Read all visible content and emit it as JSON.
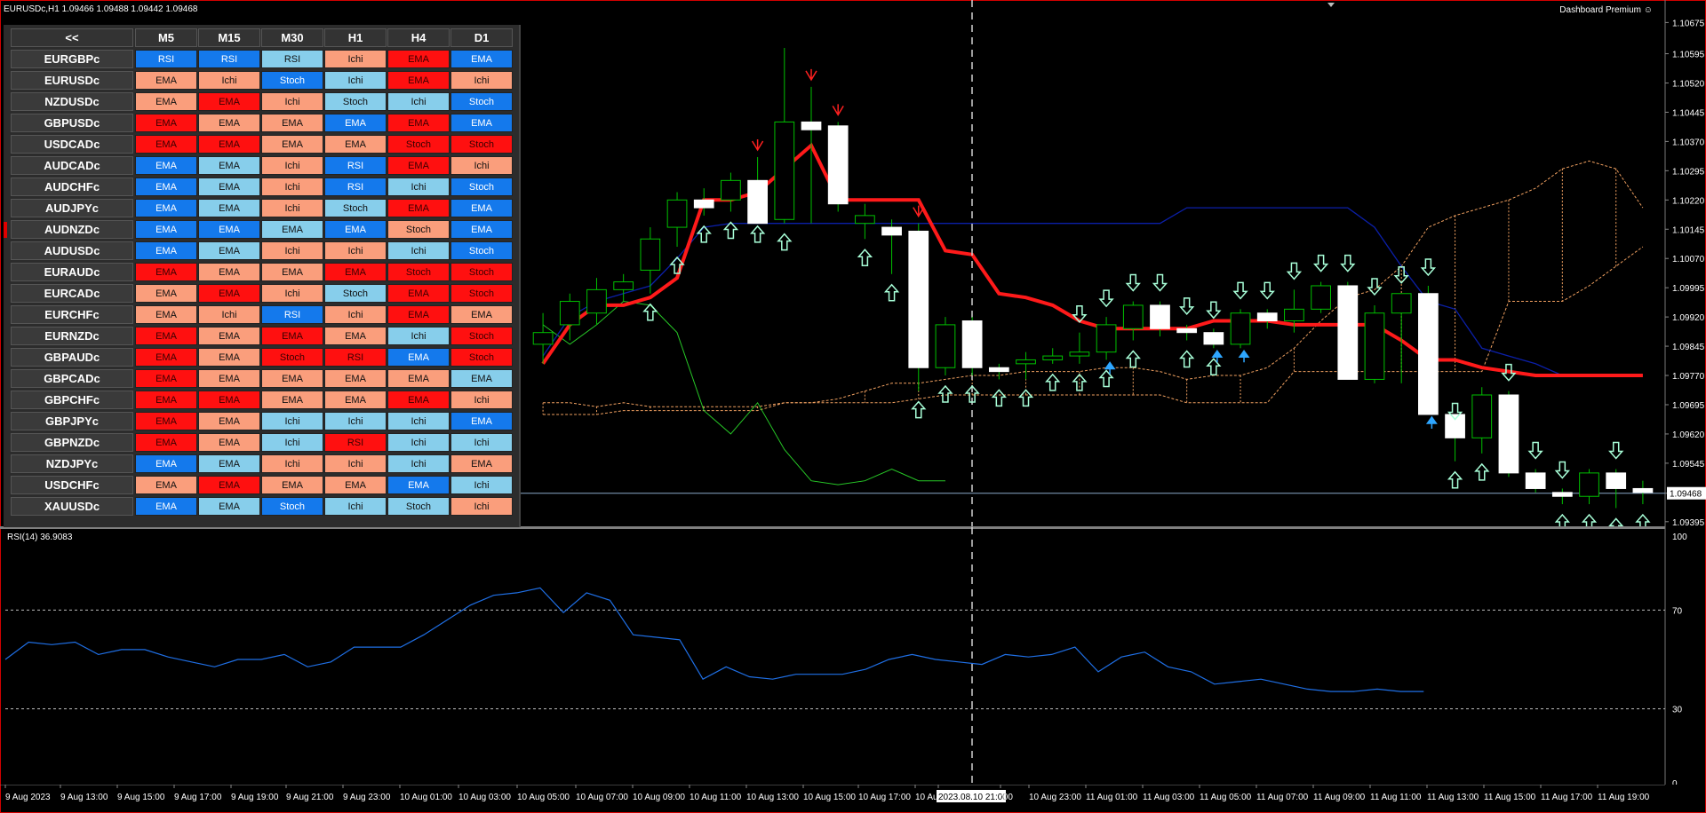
{
  "header": {
    "symbol_info": "EURUSDc,H1  1.09466 1.09488 1.09442 1.09468",
    "dashboard_title": "Dashboard Premium ☺"
  },
  "dashboard": {
    "back_label": "<<",
    "timeframes": [
      "M5",
      "M15",
      "M30",
      "H1",
      "H4",
      "D1"
    ],
    "rows": [
      {
        "symbol": "EURGBPc",
        "signals": [
          "RSI",
          "RSI",
          "RSI",
          "Ichi",
          "EMA",
          "EMA"
        ],
        "colors": [
          "blue",
          "blue",
          "lightblue",
          "salmon",
          "red",
          "blue"
        ]
      },
      {
        "symbol": "EURUSDc",
        "signals": [
          "EMA",
          "Ichi",
          "Stoch",
          "Ichi",
          "EMA",
          "Ichi"
        ],
        "colors": [
          "salmon",
          "salmon",
          "blue",
          "lightblue",
          "red",
          "salmon"
        ]
      },
      {
        "symbol": "NZDUSDc",
        "signals": [
          "EMA",
          "EMA",
          "Ichi",
          "Stoch",
          "Ichi",
          "Stoch"
        ],
        "colors": [
          "salmon",
          "red",
          "salmon",
          "lightblue",
          "lightblue",
          "blue"
        ]
      },
      {
        "symbol": "GBPUSDc",
        "signals": [
          "EMA",
          "EMA",
          "EMA",
          "EMA",
          "EMA",
          "EMA"
        ],
        "colors": [
          "red",
          "salmon",
          "salmon",
          "blue",
          "red",
          "blue"
        ]
      },
      {
        "symbol": "USDCADc",
        "signals": [
          "EMA",
          "EMA",
          "EMA",
          "EMA",
          "Stoch",
          "Stoch"
        ],
        "colors": [
          "red",
          "red",
          "salmon",
          "salmon",
          "red",
          "red"
        ]
      },
      {
        "symbol": "AUDCADc",
        "signals": [
          "EMA",
          "EMA",
          "Ichi",
          "RSI",
          "EMA",
          "Ichi"
        ],
        "colors": [
          "blue",
          "lightblue",
          "salmon",
          "blue",
          "red",
          "salmon"
        ]
      },
      {
        "symbol": "AUDCHFc",
        "signals": [
          "EMA",
          "EMA",
          "Ichi",
          "RSI",
          "Ichi",
          "Stoch"
        ],
        "colors": [
          "blue",
          "lightblue",
          "salmon",
          "blue",
          "lightblue",
          "blue"
        ]
      },
      {
        "symbol": "AUDJPYc",
        "signals": [
          "EMA",
          "EMA",
          "Ichi",
          "Stoch",
          "EMA",
          "EMA"
        ],
        "colors": [
          "blue",
          "lightblue",
          "salmon",
          "lightblue",
          "red",
          "blue"
        ]
      },
      {
        "symbol": "AUDNZDc",
        "signals": [
          "EMA",
          "EMA",
          "EMA",
          "EMA",
          "Stoch",
          "EMA"
        ],
        "colors": [
          "blue",
          "blue",
          "lightblue",
          "blue",
          "salmon",
          "blue"
        ]
      },
      {
        "symbol": "AUDUSDc",
        "signals": [
          "EMA",
          "EMA",
          "Ichi",
          "Ichi",
          "Ichi",
          "Stoch"
        ],
        "colors": [
          "blue",
          "lightblue",
          "salmon",
          "salmon",
          "lightblue",
          "blue"
        ]
      },
      {
        "symbol": "EURAUDc",
        "signals": [
          "EMA",
          "EMA",
          "EMA",
          "EMA",
          "Stoch",
          "Stoch"
        ],
        "colors": [
          "red",
          "salmon",
          "salmon",
          "red",
          "red",
          "red"
        ]
      },
      {
        "symbol": "EURCADc",
        "signals": [
          "EMA",
          "EMA",
          "Ichi",
          "Stoch",
          "EMA",
          "Stoch"
        ],
        "colors": [
          "salmon",
          "red",
          "salmon",
          "lightblue",
          "red",
          "red"
        ]
      },
      {
        "symbol": "EURCHFc",
        "signals": [
          "EMA",
          "Ichi",
          "RSI",
          "Ichi",
          "EMA",
          "EMA"
        ],
        "colors": [
          "salmon",
          "salmon",
          "blue",
          "salmon",
          "red",
          "salmon"
        ]
      },
      {
        "symbol": "EURNZDc",
        "signals": [
          "EMA",
          "EMA",
          "EMA",
          "EMA",
          "Ichi",
          "Stoch"
        ],
        "colors": [
          "red",
          "salmon",
          "red",
          "salmon",
          "lightblue",
          "red"
        ]
      },
      {
        "symbol": "GBPAUDc",
        "signals": [
          "EMA",
          "EMA",
          "Stoch",
          "RSI",
          "EMA",
          "Stoch"
        ],
        "colors": [
          "red",
          "salmon",
          "red",
          "red",
          "blue",
          "red"
        ]
      },
      {
        "symbol": "GBPCADc",
        "signals": [
          "EMA",
          "EMA",
          "EMA",
          "EMA",
          "EMA",
          "EMA"
        ],
        "colors": [
          "red",
          "salmon",
          "salmon",
          "salmon",
          "salmon",
          "lightblue"
        ]
      },
      {
        "symbol": "GBPCHFc",
        "signals": [
          "EMA",
          "EMA",
          "EMA",
          "EMA",
          "EMA",
          "Ichi"
        ],
        "colors": [
          "red",
          "red",
          "salmon",
          "salmon",
          "red",
          "salmon"
        ]
      },
      {
        "symbol": "GBPJPYc",
        "signals": [
          "EMA",
          "EMA",
          "Ichi",
          "Ichi",
          "Ichi",
          "EMA"
        ],
        "colors": [
          "red",
          "salmon",
          "lightblue",
          "lightblue",
          "lightblue",
          "blue"
        ]
      },
      {
        "symbol": "GBPNZDc",
        "signals": [
          "EMA",
          "EMA",
          "Ichi",
          "RSI",
          "Ichi",
          "Ichi"
        ],
        "colors": [
          "red",
          "salmon",
          "lightblue",
          "red",
          "lightblue",
          "lightblue"
        ]
      },
      {
        "symbol": "NZDJPYc",
        "signals": [
          "EMA",
          "EMA",
          "Ichi",
          "Ichi",
          "Ichi",
          "EMA"
        ],
        "colors": [
          "blue",
          "lightblue",
          "salmon",
          "salmon",
          "lightblue",
          "salmon"
        ]
      },
      {
        "symbol": "USDCHFc",
        "signals": [
          "EMA",
          "EMA",
          "EMA",
          "EMA",
          "EMA",
          "Ichi"
        ],
        "colors": [
          "salmon",
          "red",
          "salmon",
          "salmon",
          "blue",
          "lightblue"
        ]
      },
      {
        "symbol": "XAUUSDc",
        "signals": [
          "EMA",
          "EMA",
          "Stoch",
          "Ichi",
          "Stoch",
          "Ichi"
        ],
        "colors": [
          "blue",
          "lightblue",
          "blue",
          "lightblue",
          "lightblue",
          "salmon"
        ]
      }
    ],
    "cell_colors": {
      "blue": "#1479ec",
      "lightblue": "#87ceeb",
      "salmon": "#fa9e7c",
      "red": "#ff1010"
    },
    "marker_row": 8
  },
  "chart_data": [
    {
      "type": "candlestick",
      "symbol": "EURUSDc",
      "timeframe": "H1",
      "price_levels": [
        "1.10675",
        "1.10595",
        "1.10520",
        "1.10445",
        "1.10370",
        "1.10295",
        "1.10220",
        "1.10145",
        "1.10070",
        "1.09995",
        "1.09920",
        "1.09845",
        "1.09770",
        "1.09695",
        "1.09620",
        "1.09545",
        "1.09468",
        "1.09395"
      ],
      "current_price": 1.09468,
      "ylim": [
        1.0939,
        1.1071
      ],
      "candles": [
        [
          1.0985,
          1.0993,
          1.098,
          1.0988
        ],
        [
          1.099,
          1.0998,
          1.0986,
          1.0996
        ],
        [
          1.0993,
          1.1002,
          1.099,
          1.0999
        ],
        [
          1.0999,
          1.1003,
          1.0996,
          1.1001
        ],
        [
          1.1004,
          1.1015,
          1.0998,
          1.1012
        ],
        [
          1.1015,
          1.1024,
          1.101,
          1.1022
        ],
        [
          1.1022,
          1.1025,
          1.1018,
          1.102
        ],
        [
          1.1022,
          1.1029,
          1.1019,
          1.1027
        ],
        [
          1.1027,
          1.1033,
          1.1018,
          1.1016
        ],
        [
          1.1017,
          1.1061,
          1.1016,
          1.1042
        ],
        [
          1.1042,
          1.1051,
          1.1016,
          1.104
        ],
        [
          1.1041,
          1.1042,
          1.1019,
          1.1021
        ],
        [
          1.1016,
          1.1021,
          1.1012,
          1.1018
        ],
        [
          1.1015,
          1.1017,
          1.1003,
          1.1013
        ],
        [
          1.1014,
          1.1016,
          1.0973,
          1.0979
        ],
        [
          1.0979,
          1.0992,
          1.0977,
          1.099
        ],
        [
          1.0991,
          1.0992,
          1.0977,
          1.0979
        ],
        [
          1.0979,
          1.098,
          1.0976,
          1.0978
        ],
        [
          1.098,
          1.0983,
          1.0976,
          1.0981
        ],
        [
          1.0981,
          1.0984,
          1.098,
          1.0982
        ],
        [
          1.0982,
          1.0988,
          1.098,
          1.0983
        ],
        [
          1.0983,
          1.0992,
          1.0981,
          1.099
        ],
        [
          1.0989,
          1.0996,
          1.0986,
          1.0995
        ],
        [
          1.0995,
          1.0996,
          1.0987,
          1.0989
        ],
        [
          1.0989,
          1.099,
          1.0986,
          1.0988
        ],
        [
          1.0988,
          1.0989,
          1.0984,
          1.0985
        ],
        [
          1.0985,
          1.0994,
          1.0984,
          1.0993
        ],
        [
          1.0993,
          1.0994,
          1.0989,
          1.0991
        ],
        [
          1.0991,
          1.0999,
          1.0988,
          1.0994
        ],
        [
          1.0994,
          1.1001,
          1.0993,
          1.1
        ],
        [
          1.1,
          1.1001,
          1.0976,
          1.0976
        ],
        [
          1.0976,
          1.0995,
          1.0975,
          1.0993
        ],
        [
          1.0993,
          1.0998,
          1.0975,
          1.0998
        ],
        [
          1.0998,
          1.1,
          1.0967,
          1.0967
        ],
        [
          1.0967,
          1.0963,
          1.0955,
          1.0961
        ],
        [
          1.0961,
          1.0974,
          1.0957,
          1.0972
        ],
        [
          1.0972,
          1.0973,
          1.0951,
          1.0952
        ],
        [
          1.0952,
          1.0953,
          1.0947,
          1.0948
        ],
        [
          1.0947,
          1.0948,
          1.0944,
          1.0946
        ],
        [
          1.0946,
          1.0953,
          1.0944,
          1.0952
        ],
        [
          1.0952,
          1.0953,
          1.0943,
          1.0948
        ],
        [
          1.0948,
          1.095,
          1.0944,
          1.0947
        ]
      ],
      "red_line": [
        1.098,
        1.099,
        1.0995,
        1.0995,
        1.0997,
        1.1002,
        1.1022,
        1.1022,
        1.1024,
        1.103,
        1.1036,
        1.1022,
        1.1022,
        1.1022,
        1.1022,
        1.1009,
        1.1008,
        1.0998,
        1.0997,
        1.0995,
        1.0991,
        1.0989,
        1.0989,
        1.0989,
        1.0989,
        1.0991,
        1.0991,
        1.0991,
        1.099,
        1.099,
        1.099,
        1.099,
        1.0986,
        1.0981,
        1.0981,
        1.0979,
        1.0978,
        1.0977,
        1.0977,
        1.0977,
        1.0977,
        1.0977
      ],
      "blue_line": [
        1.0982,
        1.0992,
        1.0996,
        1.0998,
        1.1,
        1.1007,
        1.1015,
        1.1016,
        1.1016,
        1.1016,
        1.1016,
        1.1016,
        1.1016,
        1.1016,
        1.1016,
        1.1016,
        1.1016,
        1.1016,
        1.1016,
        1.1016,
        1.1016,
        1.1016,
        1.1016,
        1.1016,
        1.102,
        1.102,
        1.102,
        1.102,
        1.102,
        1.102,
        1.102,
        1.1015,
        1.1005,
        1.0996,
        1.0994,
        1.0984,
        1.0982,
        1.098,
        1.0977,
        1.0977,
        1.0977,
        1.0977
      ],
      "green_line": [
        1.099,
        1.0985,
        1.099,
        1.0996,
        1.0995,
        1.0988,
        1.0968,
        1.0962,
        1.097,
        1.0958,
        1.095,
        1.0949,
        1.095,
        1.0953,
        1.095,
        1.095
      ],
      "cloud_a": [
        1.097,
        1.097,
        1.0969,
        1.097,
        1.0969,
        1.0969,
        1.0969,
        1.0969,
        1.0969,
        1.097,
        1.097,
        1.0971,
        1.0973,
        1.0975,
        1.0975,
        1.0976,
        1.0977,
        1.0977,
        1.0978,
        1.0978,
        1.0978,
        1.0979,
        1.0979,
        1.0978,
        1.0976,
        1.0977,
        1.0977,
        1.0979,
        1.0984,
        1.0991,
        1.0997,
        1.0999,
        1.1005,
        1.1015,
        1.1018,
        1.102,
        1.1022,
        1.1025,
        1.103,
        1.1032,
        1.103,
        1.102
      ],
      "cloud_b": [
        1.0967,
        1.0967,
        1.0967,
        1.0968,
        1.0968,
        1.0968,
        1.0968,
        1.0968,
        1.0968,
        1.097,
        1.097,
        1.097,
        1.097,
        1.097,
        1.0971,
        1.0972,
        1.0972,
        1.0972,
        1.0972,
        1.0972,
        1.0972,
        1.0972,
        1.0972,
        1.0972,
        1.097,
        1.097,
        1.097,
        1.097,
        1.0978,
        1.0978,
        1.0978,
        1.0978,
        1.0978,
        1.0978,
        1.0978,
        1.0978,
        1.0996,
        1.0996,
        1.0996,
        1.1,
        1.1005,
        1.101
      ],
      "arrows_up": [
        4,
        5,
        6,
        7,
        8,
        9,
        12,
        13,
        14,
        15,
        16,
        17,
        18,
        19,
        20,
        21,
        22,
        24,
        25,
        34,
        35,
        38,
        39,
        40,
        41
      ],
      "arrows_down": [
        20,
        21,
        22,
        23,
        24,
        25,
        26,
        27,
        28,
        29,
        30,
        31,
        32,
        33,
        34,
        36,
        37,
        38,
        40
      ],
      "red_arrows_down": [
        8,
        10,
        11,
        14
      ],
      "blue_arrows_up": [
        21,
        25,
        26,
        33
      ]
    },
    {
      "type": "line",
      "title": "RSI(14) 36.9083",
      "levels": [
        30,
        70
      ],
      "ylim": [
        0,
        100
      ],
      "tick_labels": [
        "100",
        "70",
        "30",
        "0"
      ],
      "values": [
        50,
        57,
        56,
        57,
        52,
        54,
        54,
        51,
        49,
        47,
        50,
        50,
        52,
        47,
        49,
        55,
        55,
        55,
        60,
        66,
        72,
        76,
        77,
        79,
        69,
        77,
        74,
        60,
        59,
        58,
        42,
        47,
        43,
        42,
        44,
        44,
        44,
        46,
        50,
        52,
        50,
        49,
        48,
        52,
        51,
        52,
        55,
        45,
        51,
        53,
        47,
        45,
        40,
        41,
        42,
        40,
        38,
        37,
        37,
        38,
        37,
        37
      ]
    }
  ],
  "time_axis": {
    "labels": [
      "9 Aug 2023",
      "9 Aug 13:00",
      "9 Aug 15:00",
      "9 Aug 17:00",
      "9 Aug 19:00",
      "9 Aug 21:00",
      "9 Aug 23:00",
      "10 Aug 01:00",
      "10 Aug 03:00",
      "10 Aug 05:00",
      "10 Aug 07:00",
      "10 Aug 09:00",
      "10 Aug 11:00",
      "10 Aug 13:00",
      "10 Aug 15:00",
      "10 Aug 17:00",
      "10 Au",
      "2023.08.10 21:00",
      ":00",
      "10 Aug 23:00",
      "11 Aug 01:00",
      "11 Aug 03:00",
      "11 Aug 05:00",
      "11 Aug 07:00",
      "11 Aug 09:00",
      "11 Aug 11:00",
      "11 Aug 13:00",
      "11 Aug 15:00",
      "11 Aug 17:00",
      "11 Aug 19:00"
    ],
    "crosshair_label": "2023.08.10 21:00"
  },
  "colors": {
    "frame": "#d20000",
    "bull_candle": "#00c000",
    "bear_candle": "#ffffff",
    "red_line": "#ff1a1a",
    "blue_line": "#0b1fa8",
    "green_line": "#27c927",
    "cloud": "#f0a060",
    "rsi_line": "#1f6fe5",
    "arrow": "#a8ffd8",
    "blue_arrow": "#2ea6ff"
  }
}
